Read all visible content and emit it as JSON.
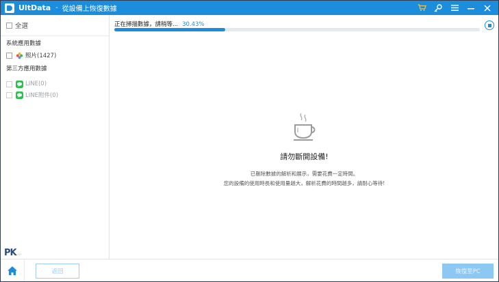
{
  "titlebar": {
    "app_name": "UltData",
    "separator": "-",
    "subtitle": "從設備上恢復數據",
    "icons": [
      "cart-icon",
      "key-icon",
      "menu-icon",
      "minimize-icon",
      "close-icon"
    ],
    "accent_color": "#1c8ddb",
    "cart_color": "#f5c142"
  },
  "sidebar": {
    "select_all_label": "全選",
    "sections": [
      {
        "title": "系統應用數據",
        "items": [
          {
            "label": "照片(1427)",
            "icon": "photos-icon",
            "enabled": true
          }
        ]
      },
      {
        "title": "第三方應用數據",
        "items": [
          {
            "label": "LINE(0)",
            "icon": "line-icon",
            "enabled": false
          },
          {
            "label": "LINE附件(0)",
            "icon": "line-icon",
            "enabled": false
          }
        ]
      }
    ]
  },
  "scan": {
    "status_text": "正在掃描數據，請稍等...",
    "percent_text": "30.43%",
    "progress": 0.3043
  },
  "message": {
    "headline": "請勿斷開設備!",
    "line1": "已刪除數據的解析和展示，需要花費一定時間。",
    "line2": "您的設備的使用時長和使用量越大，解析花費的時間越多，請耐心等待!"
  },
  "watermark": {
    "text": "PK",
    "small": "‹‹‹"
  },
  "bottombar": {
    "back_label": "返回",
    "recover_label": "恢復至PC"
  }
}
